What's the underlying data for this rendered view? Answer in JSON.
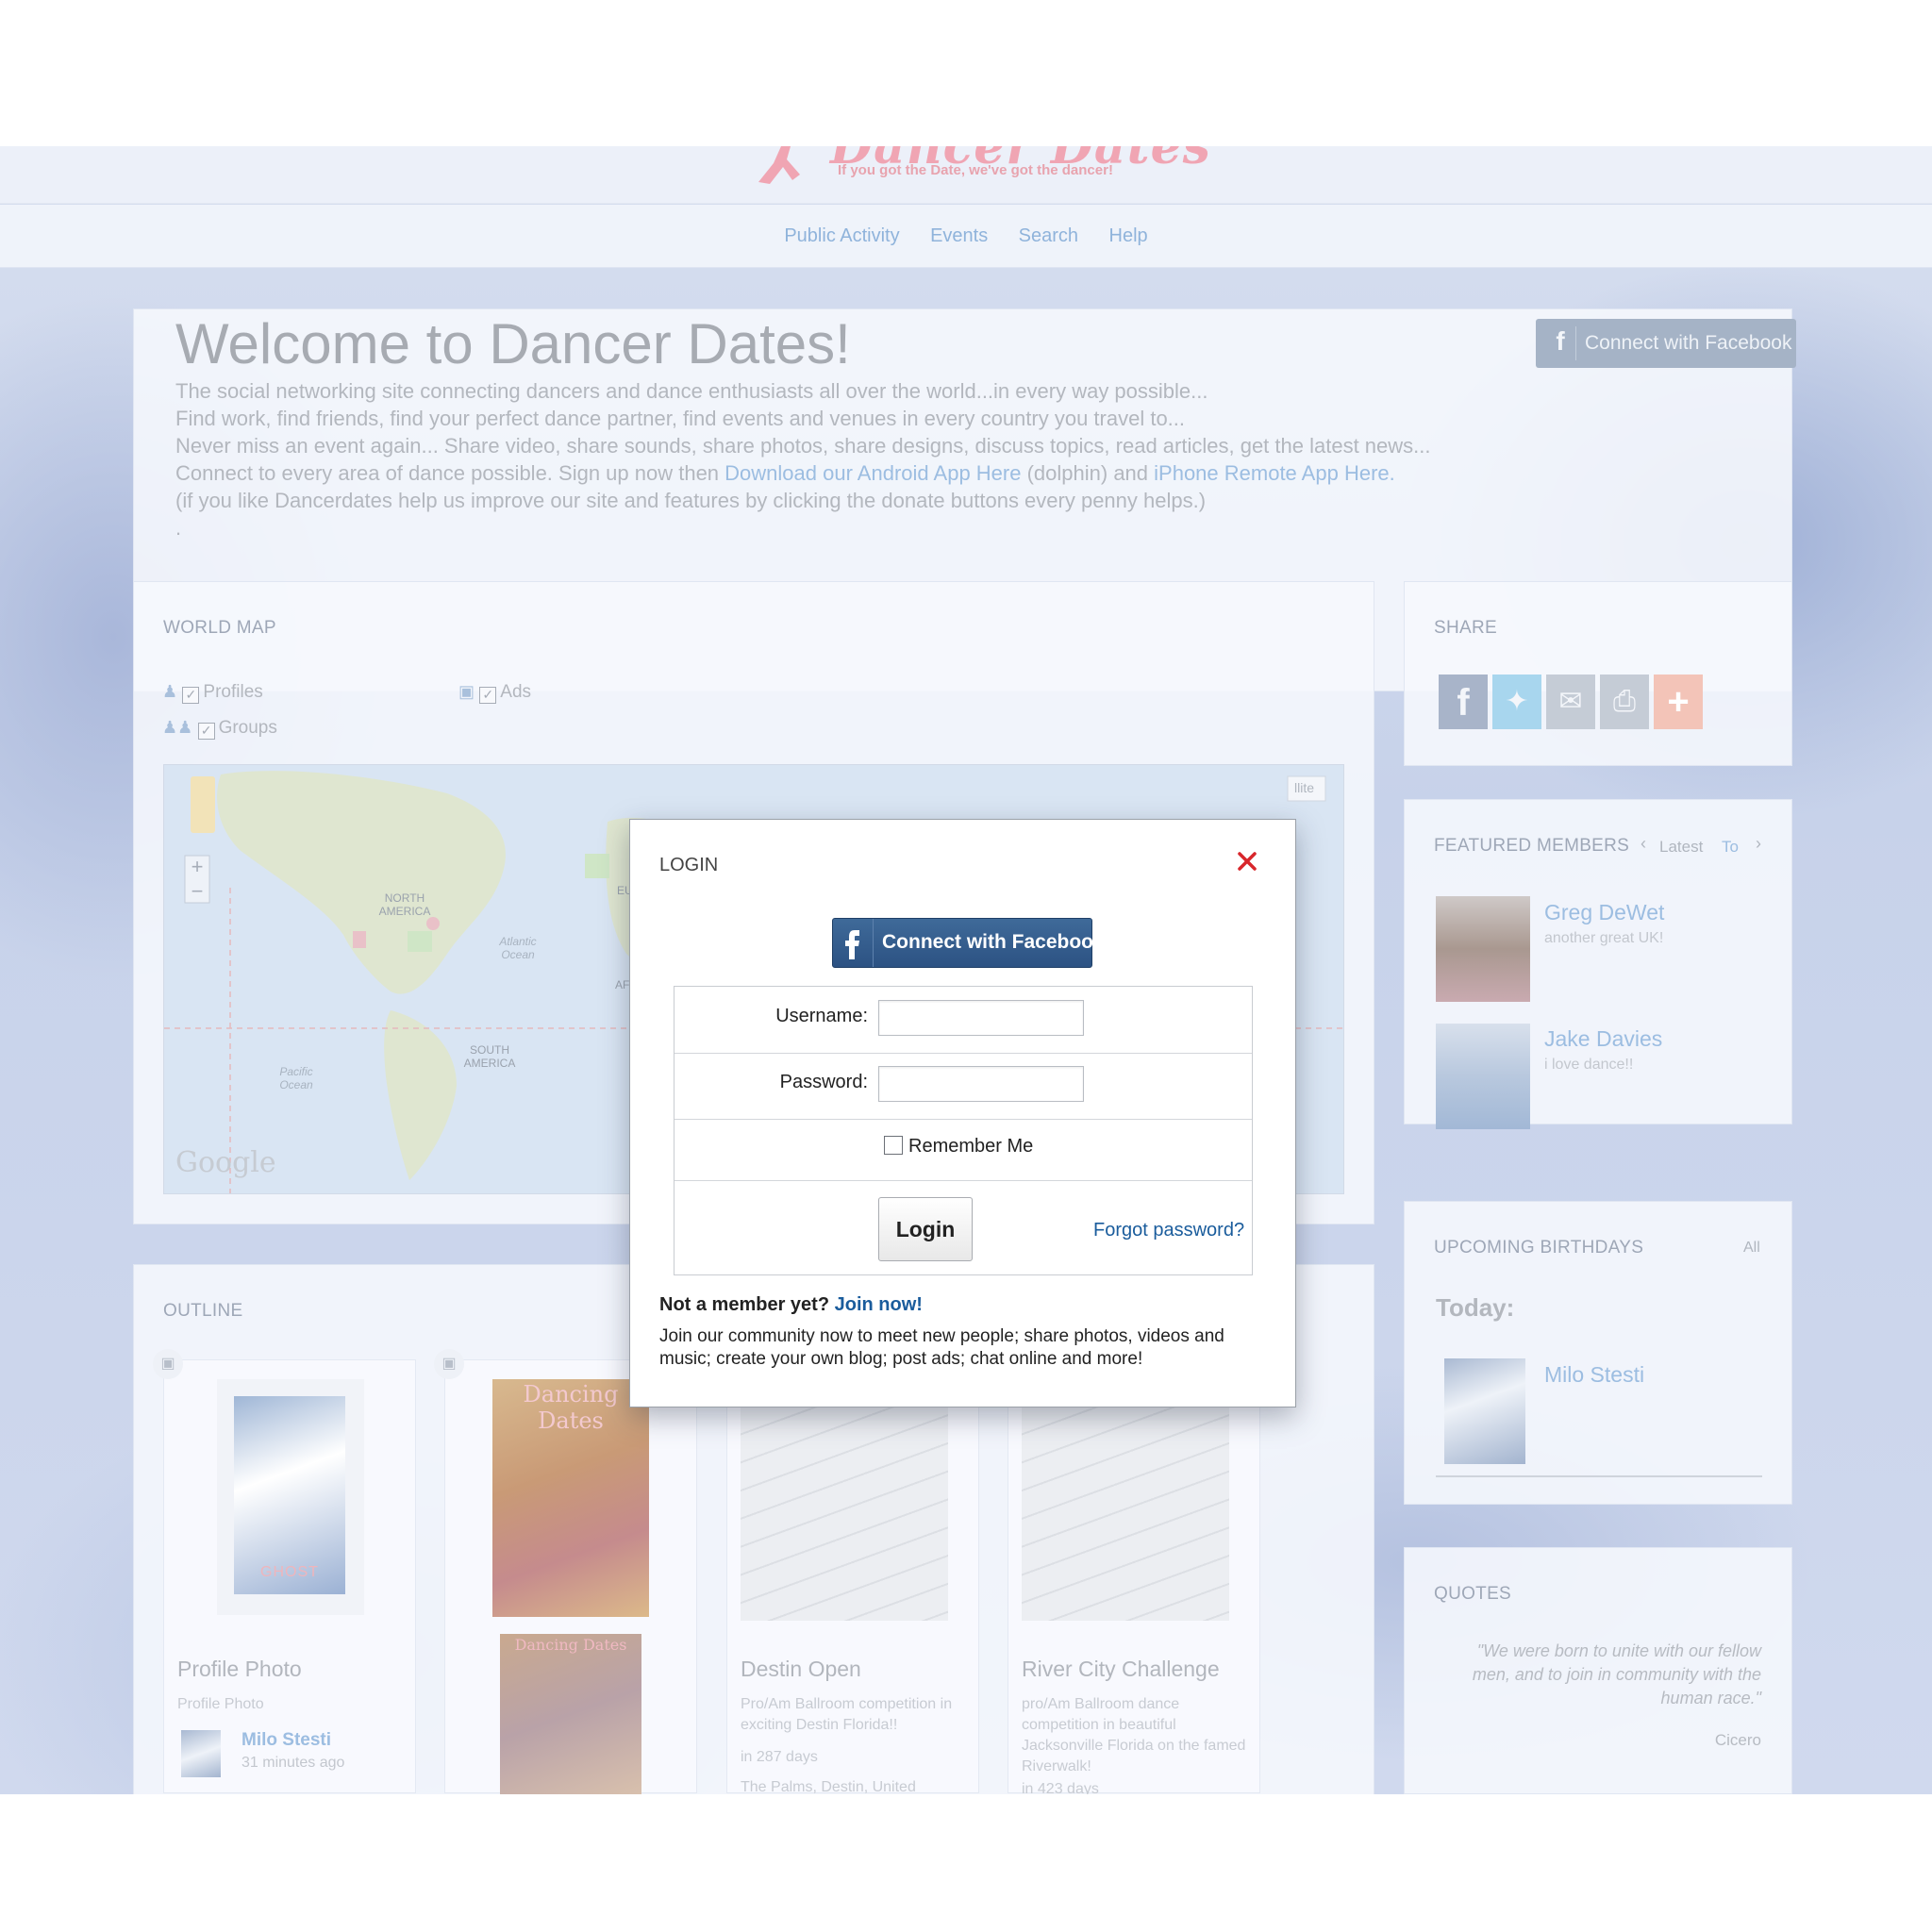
{
  "header": {
    "logo_title": "Dancer Dates",
    "tagline": "If you got the Date, we've got the dancer!",
    "nav": [
      "Public Activity",
      "Events",
      "Search",
      "Help"
    ]
  },
  "welcome": {
    "title": "Welcome to Dancer Dates!",
    "line1": "The social networking site connecting dancers and dance enthusiasts all over the world...in every way possible...",
    "line2": "Find work, find friends, find your perfect dance partner, find events and venues in every country you travel to...",
    "line3": "Never miss an event again... Share video, share sounds, share photos, share designs, discuss topics, read articles, get the latest news...",
    "line4_prefix": "Connect to every area of dance possible. Sign up now then ",
    "line4_android": "Download our Android App Here",
    "line4_mid": " (dolphin) and ",
    "line4_iphone": "iPhone Remote App Here.",
    "line5": "(if you like Dancerdates help us improve our site and features by clicking the donate buttons every penny helps.)",
    "line6": ".",
    "fb_button": "Connect with Facebook"
  },
  "world_map": {
    "title": "WORLD MAP",
    "filters": [
      "Profiles",
      "Ads",
      "Groups"
    ],
    "labels": {
      "north_america": "NORTH AMERICA",
      "south_america": "SOUTH AMERICA",
      "atlantic": "Atlantic Ocean",
      "pacific": "Pacific Ocean",
      "europe_partial": "EU",
      "africa_partial": "AF",
      "satellite_partial": "llite",
      "google": "Google"
    }
  },
  "share": {
    "title": "SHARE",
    "icons": [
      "facebook-icon",
      "twitter-icon",
      "email-icon",
      "print-icon",
      "plus-icon"
    ]
  },
  "featured": {
    "title": "FEATURED MEMBERS",
    "tab_latest": "Latest",
    "tab_top": "To",
    "members": [
      {
        "name": "Greg DeWet",
        "note": "another great UK!"
      },
      {
        "name": "Jake Davies",
        "note": "i love dance!!"
      }
    ]
  },
  "birthdays": {
    "title": "UPCOMING BIRTHDAYS",
    "all": "All",
    "today": "Today:",
    "person": "Milo Stesti"
  },
  "quotes": {
    "title": "QUOTES",
    "text": "\"We were born to unite with our fellow men, and to join in community with the human race.\"",
    "author": "Cicero"
  },
  "outline": {
    "title": "OUTLINE",
    "cards": [
      {
        "title": "Profile Photo",
        "sub": "Profile Photo",
        "user": "Milo Stesti",
        "time": "31 minutes ago",
        "poster_text": "GHOST"
      },
      {
        "poster_top": "Dancing Dates",
        "poster_bottom": "Dancing Dates"
      },
      {
        "title": "Destin Open",
        "desc": "Pro/Am Ballroom competition in exciting Destin Florida!!",
        "when": "in 287 days",
        "where": "The Palms, Destin, United"
      },
      {
        "title": "River City Challenge",
        "desc": "pro/Am Ballroom dance competition in beautiful Jacksonville Florida on the famed Riverwalk!",
        "when": "in 423 days"
      }
    ]
  },
  "modal": {
    "title": "LOGIN",
    "fb_button": "Connect with Facebook",
    "username_label": "Username:",
    "password_label": "Password:",
    "remember_label": "Remember Me",
    "login_button": "Login",
    "forgot": "Forgot password?",
    "not_member": "Not a member yet?",
    "join": "Join now!",
    "join_desc": "Join our community now to meet new people; share photos, videos and music; create your own blog; post ads; chat online and more!"
  },
  "colors": {
    "facebook": "#2c5283",
    "link": "#1a5c9c",
    "close": "#d8262b"
  }
}
